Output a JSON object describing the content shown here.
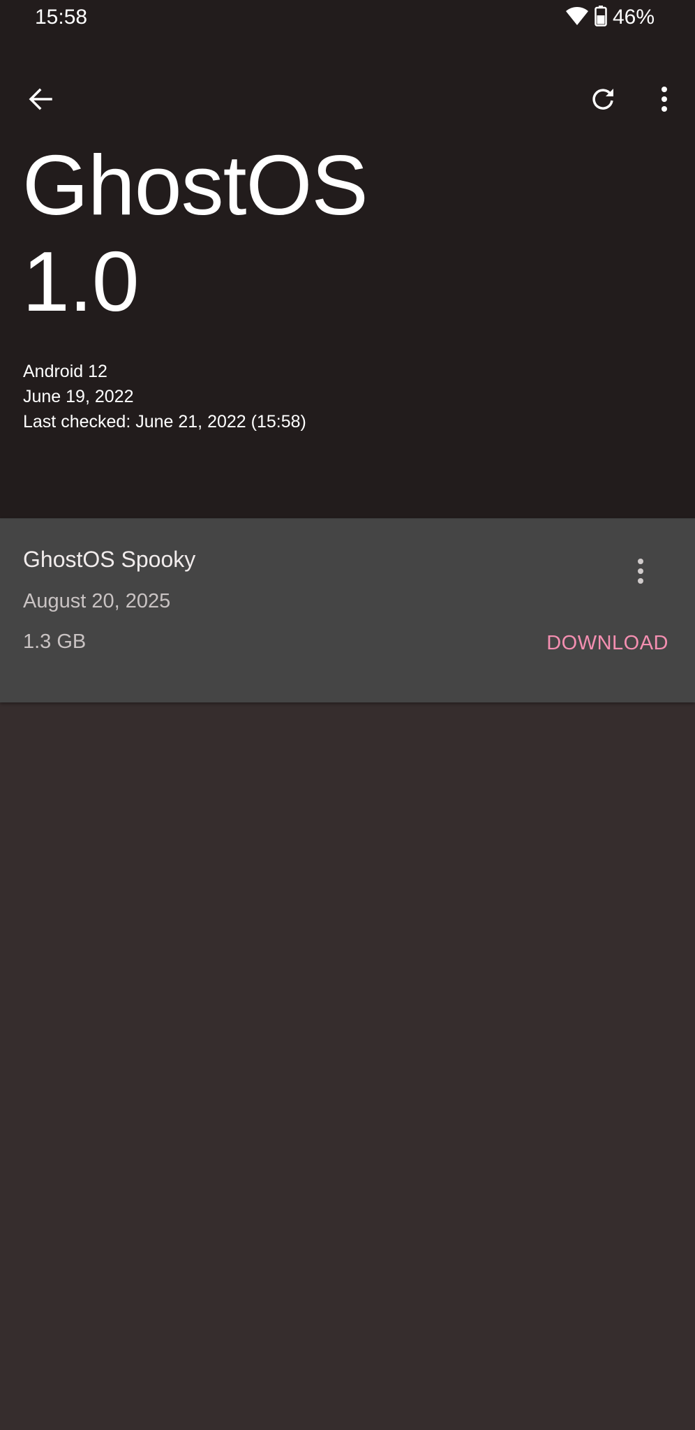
{
  "status_bar": {
    "time": "15:58",
    "battery_percent": "46%",
    "icons": [
      "wifi-icon",
      "battery-icon"
    ]
  },
  "toolbar": {
    "icons": [
      "arrow-left-icon",
      "refresh-icon",
      "more-vertical-icon"
    ]
  },
  "os": {
    "name": "GhostOS",
    "version": "1.0",
    "android_version": "Android 12",
    "build_date": "June 19, 2022",
    "last_checked": "Last checked: June 21, 2022 (15:58)"
  },
  "update": {
    "title": "GhostOS Spooky",
    "date": "August 20, 2025",
    "size": "1.3 GB",
    "download_label": "DOWNLOAD",
    "accent_color": "#f48fb1"
  },
  "colors": {
    "header_bg": "#221c1c",
    "body_bg": "#362d2d",
    "card_bg": "#454545"
  }
}
